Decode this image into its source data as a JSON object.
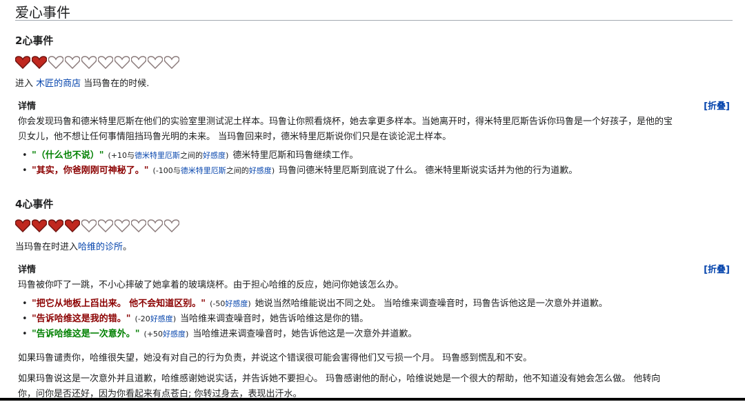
{
  "section_title": "爱心事件",
  "events": [
    {
      "heading": "2心事件",
      "hearts_filled": 2,
      "hearts_total": 10,
      "intro": {
        "pre": "进入 ",
        "link": "木匠的商店",
        "post": " 当玛鲁在的时候."
      },
      "details_label": "详情",
      "collapse_label": "[折叠]",
      "description_lines": [
        "你会发现玛鲁和德米特里厄斯在他们的实验室里测试泥土样本。玛鲁让你照看烧杯，她去拿更多样本。当她离开时，得米特里厄斯告诉你玛鲁是一个好孩子，是他的宝",
        "贝女儿，他不想让任何事情阻挡玛鲁光明的未来。 当玛鲁回来时，德米特里厄斯说你们只是在谈论泥土样本。"
      ],
      "choices": [
        {
          "quote": "\"（什么也不说）\"",
          "color": "green",
          "meta_pre": "(+10与",
          "meta_link1": "德米特里厄斯",
          "meta_mid": "之间的",
          "meta_link2": "好感度",
          "meta_post": ")",
          "result": "德米特里厄斯和玛鲁继续工作。"
        },
        {
          "quote": "\"其实，你爸刚刚可神秘了。\"",
          "color": "red",
          "meta_pre": "(-100与",
          "meta_link1": "德米特里厄斯",
          "meta_mid": "之间的",
          "meta_link2": "好感度",
          "meta_post": ")",
          "result": "玛鲁问德米特里厄斯到底说了什么。 德米特里斯说实话并为他的行为道歉。"
        }
      ]
    },
    {
      "heading": "4心事件",
      "hearts_filled": 4,
      "hearts_total": 10,
      "intro": {
        "pre": "当玛鲁在时进入",
        "link": "哈维的诊所",
        "post": "。"
      },
      "details_label": "详情",
      "collapse_label": "[折叠]",
      "description_lines": [
        "玛鲁被你吓了一跳，不小心摔破了她拿着的玻璃烧杯。由于担心哈维的反应，她问你她该怎么办。"
      ],
      "choices": [
        {
          "quote": "\"把它从地板上舀出来。 他不会知道区别。\"",
          "color": "red",
          "meta_pre": "(-50",
          "meta_link1": "",
          "meta_mid": "",
          "meta_link2": "好感度",
          "meta_post": ")",
          "result": "她说当然哈维能说出不同之处。 当哈维来调查噪音时，玛鲁告诉他这是一次意外并道歉。"
        },
        {
          "quote": "\"告诉哈维这是我的错。\"",
          "color": "red",
          "meta_pre": "(-20",
          "meta_link1": "",
          "meta_mid": "",
          "meta_link2": "好感度",
          "meta_post": ")",
          "result": "当哈维来调查噪音时，她告诉哈维这是你的错。"
        },
        {
          "quote": "\"告诉哈维这是一次意外。\"",
          "color": "green",
          "meta_pre": "(+50",
          "meta_link1": "",
          "meta_mid": "",
          "meta_link2": "好感度",
          "meta_post": ")",
          "result": "当哈维进来调查噪音时，她告诉他这是一次意外并道歉。"
        }
      ],
      "after_paragraphs": [
        "如果玛鲁谴责你，哈维很失望，她没有对自己的行为负责，并说这个错误很可能会害得他们又亏损一个月。 玛鲁感到慌乱和不安。",
        "如果玛鲁说这是一次意外并且道歉，哈维感谢她说实话，并告诉她不要担心。 玛鲁感谢他的耐心，哈维说她是一个很大的帮助，他不知道没有她会怎么做。 他转向",
        "你，问你是否还好，因为你看起来有点苍白; 你转过身去，表现出汗水。"
      ]
    }
  ],
  "colors": {
    "heart_filled": "#c0281f",
    "heart_empty_outline": "#8a7a7a",
    "link": "#0645ad",
    "good_choice": "#008000",
    "bad_choice": "#8b0000"
  }
}
